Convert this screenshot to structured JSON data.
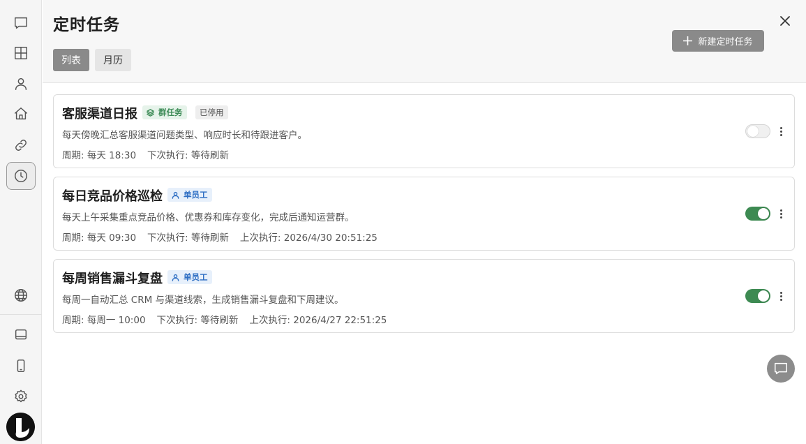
{
  "page": {
    "title": "定时任务",
    "close_icon": "close-icon",
    "new_button_label": "新建定时任务",
    "tabs": [
      {
        "label": "列表",
        "active": true
      },
      {
        "label": "月历",
        "active": false
      }
    ]
  },
  "sidebar": {
    "items": [
      {
        "name": "chat",
        "icon": "chat-bubble-icon"
      },
      {
        "name": "dashboard",
        "icon": "grid-icon"
      },
      {
        "name": "user",
        "icon": "user-icon"
      },
      {
        "name": "home",
        "icon": "home-icon"
      },
      {
        "name": "link",
        "icon": "link-icon"
      },
      {
        "name": "scheduled-tasks",
        "icon": "clock-icon",
        "active": true
      },
      {
        "name": "language",
        "icon": "globe-icon"
      },
      {
        "name": "desktop",
        "icon": "monitor-icon"
      },
      {
        "name": "mobile",
        "icon": "phone-icon"
      },
      {
        "name": "settings",
        "icon": "gear-icon"
      }
    ]
  },
  "tasks": [
    {
      "title": "客服渠道日报",
      "type_badge": "群任务",
      "type_icon": "layers-icon",
      "status_badge": "已停用",
      "description": "每天傍晚汇总客服渠道问题类型、响应时长和待跟进客户。",
      "schedule": "周期: 每天 18:30",
      "next_run": "下次执行: 等待刷新",
      "last_run": "",
      "enabled": false
    },
    {
      "title": "每日竞品价格巡检",
      "type_badge": "单员工",
      "type_icon": "user-icon",
      "status_badge": "",
      "description": "每天上午采集重点竞品价格、优惠券和库存变化，完成后通知运营群。",
      "schedule": "周期: 每天 09:30",
      "next_run": "下次执行: 等待刷新",
      "last_run": "上次执行: 2026/4/30 20:51:25",
      "enabled": true
    },
    {
      "title": "每周销售漏斗复盘",
      "type_badge": "单员工",
      "type_icon": "user-icon",
      "status_badge": "",
      "description": "每周一自动汇总 CRM 与渠道线索，生成销售漏斗复盘和下周建议。",
      "schedule": "周期: 每周一 10:00",
      "next_run": "下次执行: 等待刷新",
      "last_run": "上次执行: 2026/4/27 22:51:25",
      "enabled": true
    }
  ],
  "colors": {
    "toggle_on": "#3d8a52",
    "primary_button": "#8a8a8a",
    "group_badge_text": "#3b8a55",
    "single_badge_text": "#2f6fc4"
  }
}
